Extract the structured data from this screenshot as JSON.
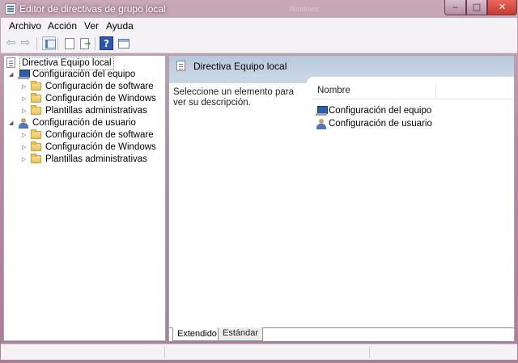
{
  "window": {
    "title": "Editor de directivas de grupo local",
    "ghost_title": "Windows",
    "min_glyph": "‒",
    "max_glyph": "□",
    "close_glyph": "✕"
  },
  "menu": {
    "items": [
      "Archivo",
      "Acción",
      "Ver",
      "Ayuda"
    ]
  },
  "toolbar": {
    "back_glyph": "⇦",
    "forward_glyph": "⇨",
    "help_glyph": "?"
  },
  "tree": {
    "root": "Directiva Equipo local",
    "computer": {
      "label": "Configuración del equipo",
      "children": [
        "Configuración de software",
        "Configuración de Windows",
        "Plantillas administrativas"
      ]
    },
    "user": {
      "label": "Configuración de usuario",
      "children": [
        "Configuración de software",
        "Configuración de Windows",
        "Plantillas administrativas"
      ]
    },
    "expanded_glyph": "◢",
    "collapsed_glyph": "▷"
  },
  "details": {
    "title": "Directiva Equipo local",
    "description": "Seleccione un elemento para ver su descripción.",
    "column_name": "Nombre",
    "items": [
      "Configuración del equipo",
      "Configuración de usuario"
    ]
  },
  "tabs": {
    "extended": "Extendido",
    "standard": "Estándar"
  },
  "colors": {
    "desktop_accent": "#7a1a3a",
    "header_blue": "#b8c8dc",
    "close_red": "#c43a2c"
  },
  "icons": [
    "app-icon",
    "back-arrow-icon",
    "forward-arrow-icon",
    "console-tree-icon",
    "properties-icon",
    "export-list-icon",
    "help-icon",
    "view-icon",
    "policy-icon",
    "computer-icon",
    "user-icon",
    "folder-icon"
  ]
}
